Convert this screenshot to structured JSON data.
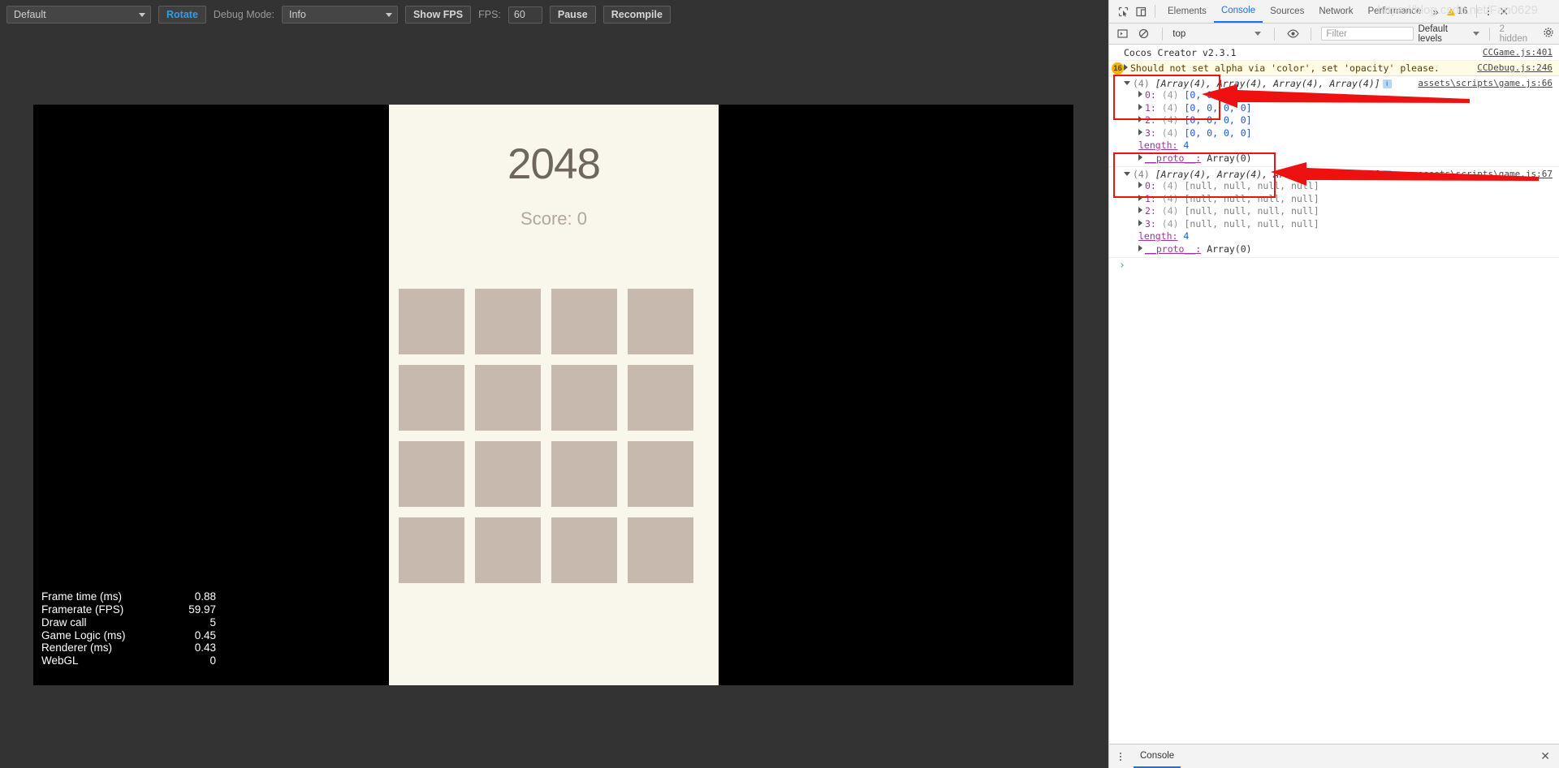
{
  "simulator": {
    "toolbar": {
      "device_select": "Default",
      "rotate_label": "Rotate",
      "debug_mode_label": "Debug Mode:",
      "debug_mode_select": "Info",
      "show_fps_label": "Show FPS",
      "fps_label": "FPS:",
      "fps_value": "60",
      "pause_label": "Pause",
      "recompile_label": "Recompile"
    },
    "game": {
      "title": "2048",
      "score": "Score: 0",
      "tile_count": 16,
      "tile_color": "#c7b9ae",
      "board_bg": "#f9f6ec"
    },
    "stats": [
      {
        "key": "Frame time (ms)",
        "value": "0.88"
      },
      {
        "key": "Framerate (FPS)",
        "value": "59.97"
      },
      {
        "key": "Draw call",
        "value": "5"
      },
      {
        "key": "Game Logic (ms)",
        "value": "0.45"
      },
      {
        "key": "Renderer (ms)",
        "value": "0.43"
      },
      {
        "key": "WebGL",
        "value": "0"
      }
    ]
  },
  "devtools": {
    "tabs": [
      {
        "label": "Elements",
        "active": false
      },
      {
        "label": "Console",
        "active": true
      },
      {
        "label": "Sources",
        "active": false
      },
      {
        "label": "Network",
        "active": false
      },
      {
        "label": "Performance",
        "active": false
      }
    ],
    "more_glyph": "»",
    "warning_count": "16",
    "close_glyph": "✕",
    "console_toolbar": {
      "context": "top",
      "filter_placeholder": "Filter",
      "levels": "Default levels",
      "hidden": "2 hidden"
    },
    "logs": {
      "line1_text": "Cocos Creator v2.3.1",
      "line1_source": "CCGame.js:401",
      "line2_badge": "16",
      "line2_text": "Should not set alpha via 'color', set 'opacity' please.",
      "line2_source": "CCDebug.js:246",
      "group1": {
        "header_count": "(4)",
        "header_text": "[Array(4), Array(4), Array(4), Array(4)]",
        "source": "assets\\scripts\\game.js:66",
        "rows": [
          {
            "index": "0:",
            "count": "(4)",
            "value": "[0, 0, 0, 0]"
          },
          {
            "index": "1:",
            "count": "(4)",
            "value": "[0, 0, 0, 0]"
          },
          {
            "index": "2:",
            "count": "(4)",
            "value": "[0, 0, 0, 0]"
          },
          {
            "index": "3:",
            "count": "(4)",
            "value": "[0, 0, 0, 0]"
          }
        ],
        "length_key": "length:",
        "length_value": "4",
        "proto_key": "__proto__:",
        "proto_value": "Array(0)"
      },
      "group2": {
        "header_count": "(4)",
        "header_text": "[Array(4), Array(4), Array(4), Array(4)]",
        "source": "assets\\scripts\\game.js:67",
        "rows": [
          {
            "index": "0:",
            "count": "(4)",
            "value": "[null, null, null, null]"
          },
          {
            "index": "1:",
            "count": "(4)",
            "value": "[null, null, null, null]"
          },
          {
            "index": "2:",
            "count": "(4)",
            "value": "[null, null, null, null]"
          },
          {
            "index": "3:",
            "count": "(4)",
            "value": "[null, null, null, null]"
          }
        ],
        "length_key": "length:",
        "length_value": "4",
        "proto_key": "__proto__:",
        "proto_value": "Array(0)"
      }
    },
    "statusbar": {
      "drawer_tab": "Console",
      "watermark": "https://blog.csdn.net/Fan0629",
      "close_glyph": "✕"
    },
    "accent_color": "#1a73e8",
    "annotation_color": "#ee1111"
  }
}
